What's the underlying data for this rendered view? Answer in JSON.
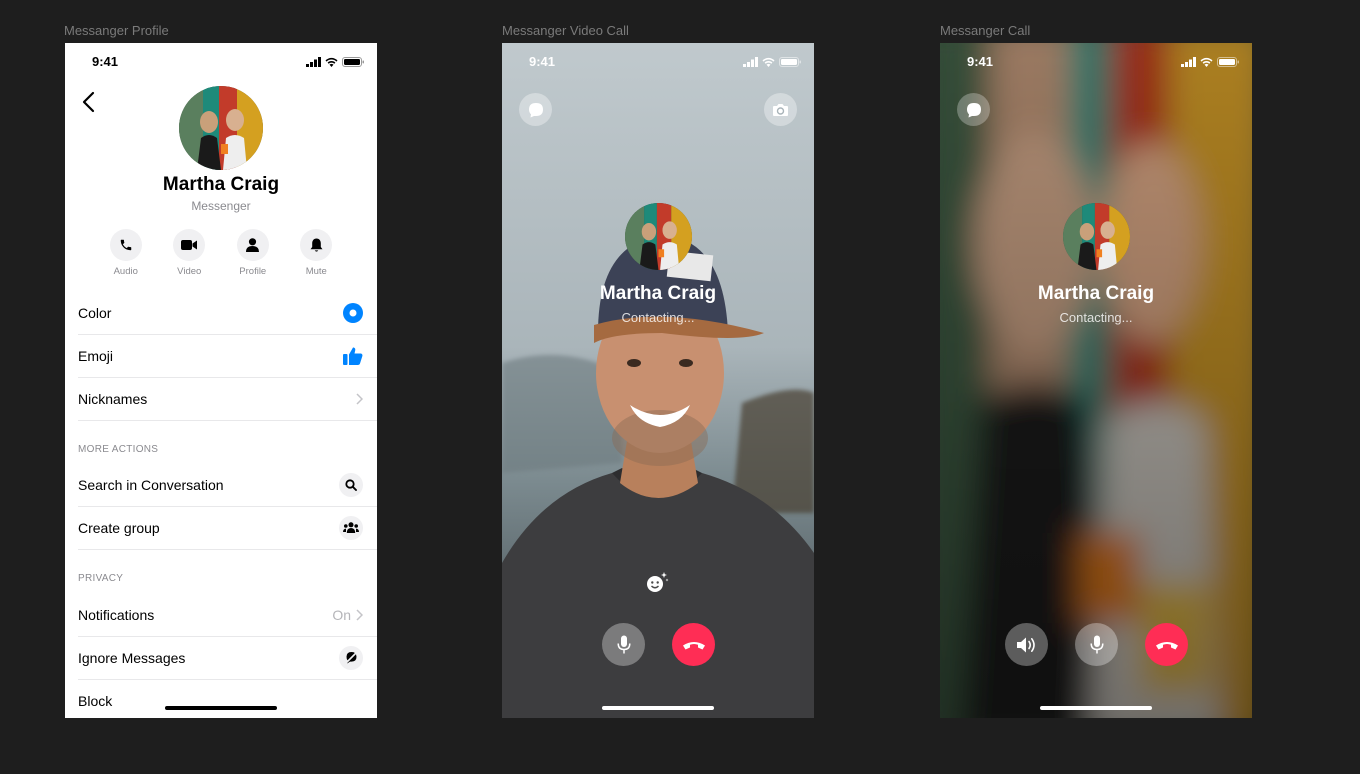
{
  "frames": [
    {
      "label": "Messanger Profile"
    },
    {
      "label": "Messanger Video Call"
    },
    {
      "label": "Messanger Call"
    }
  ],
  "status_time": "9:41",
  "profile": {
    "name": "Martha Craig",
    "subtitle": "Messenger",
    "actions": [
      {
        "label": "Audio",
        "icon": "phone-icon"
      },
      {
        "label": "Video",
        "icon": "video-icon"
      },
      {
        "label": "Profile",
        "icon": "person-icon"
      },
      {
        "label": "Mute",
        "icon": "bell-icon"
      }
    ],
    "rows_top": [
      {
        "label": "Color"
      },
      {
        "label": "Emoji"
      },
      {
        "label": "Nicknames"
      }
    ],
    "section_more": "MORE ACTIONS",
    "rows_more": [
      {
        "label": "Search in Conversation"
      },
      {
        "label": "Create group"
      }
    ],
    "section_privacy": "PRIVACY",
    "rows_privacy": [
      {
        "label": "Notifications",
        "value": "On"
      },
      {
        "label": "Ignore Messages"
      },
      {
        "label": "Block"
      }
    ],
    "accent": "#0084ff"
  },
  "video_call": {
    "name": "Martha Craig",
    "status": "Contacting..."
  },
  "audio_call": {
    "name": "Martha Craig",
    "status": "Contacting..."
  },
  "colors": {
    "end_call": "#ff2d55",
    "background": "#1e1e1e"
  }
}
